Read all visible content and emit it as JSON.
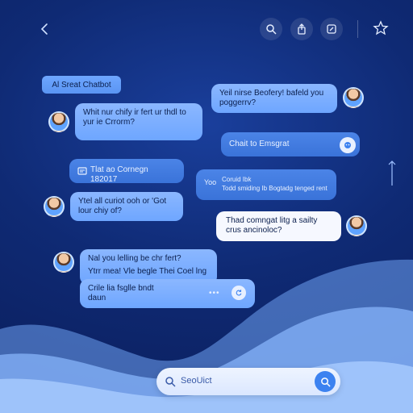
{
  "header": {
    "back_icon": "chevron-left-icon",
    "actions": [
      "search-icon",
      "share-icon",
      "edit-icon",
      "star-icon"
    ]
  },
  "chat_label": "Al Sreat Chatbot",
  "messages": {
    "m1": "Yeil nirse Beofery! bafeld you poggerrv?",
    "m2": "Whit nur chify ir fert ur thdl to yur ie Crrorm?",
    "m3": "Chait to Emsgrat",
    "m4": "Tlat ao Cornegn 182017",
    "m5_prefix": "Yoo",
    "m5_line1": "Coruid Ibk",
    "m5_line2": "Todd smiding Ib Bogtadg tenged rent",
    "m6": "Ytel all curiot ooh or 'Got lour chiy of?",
    "m7": "Thad comngat litg a sailty crus ancinoloc?",
    "m8_line1": "Nal you lelling be chr fert?",
    "m8_line2": "Ytrr mea! Vle begle Thei Coel lng",
    "m9": "Crile lia fsglle bndt daun"
  },
  "search": {
    "placeholder": "SeoUict"
  },
  "colors": {
    "bg_dark": "#0a1d5a",
    "bubble_light": "#7eb0ff",
    "bubble_blue": "#3f78de",
    "accent": "#3c82f0"
  }
}
